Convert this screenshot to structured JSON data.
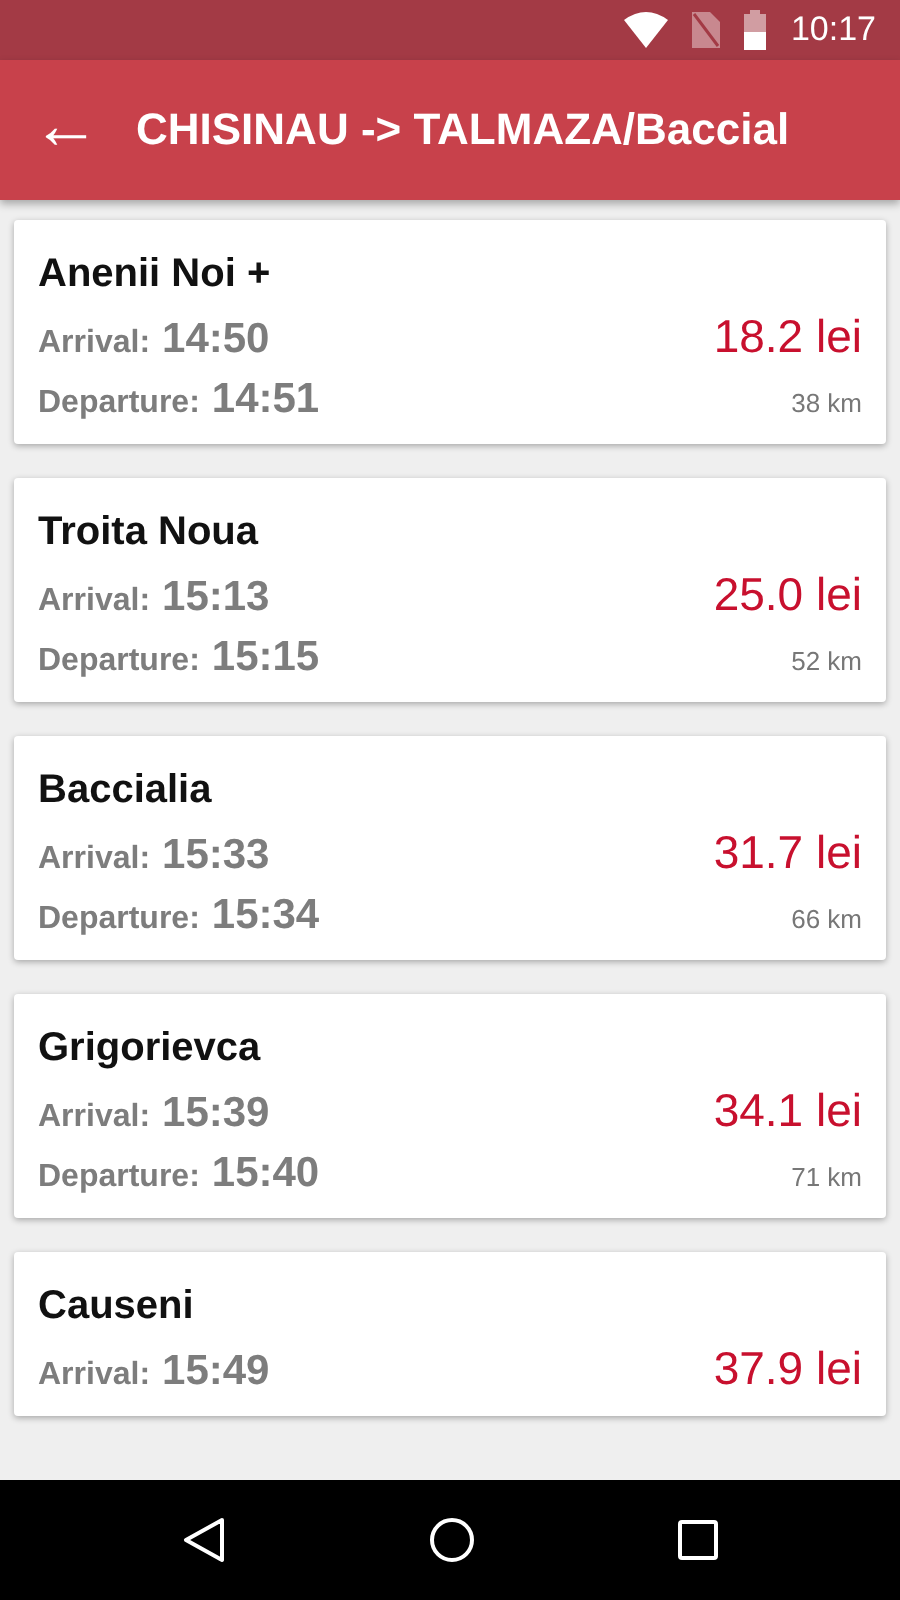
{
  "status_bar": {
    "time": "10:17"
  },
  "header": {
    "back": "←",
    "title": "CHISINAU -> TALMAZA/Baccial"
  },
  "stops": [
    {
      "name": "Anenii Noi +",
      "arrival_label": "Arrival:",
      "arrival": "14:50",
      "departure_label": "Departure:",
      "departure": "14:51",
      "price": "18.2 lei",
      "distance": "38 km"
    },
    {
      "name": "Troita Noua",
      "arrival_label": "Arrival:",
      "arrival": "15:13",
      "departure_label": "Departure:",
      "departure": "15:15",
      "price": "25.0 lei",
      "distance": "52 km"
    },
    {
      "name": "Baccialia",
      "arrival_label": "Arrival:",
      "arrival": "15:33",
      "departure_label": "Departure:",
      "departure": "15:34",
      "price": "31.7 lei",
      "distance": "66 km"
    },
    {
      "name": "Grigorievca",
      "arrival_label": "Arrival:",
      "arrival": "15:39",
      "departure_label": "Departure:",
      "departure": "15:40",
      "price": "34.1 lei",
      "distance": "71 km"
    },
    {
      "name": "Causeni",
      "arrival_label": "Arrival:",
      "arrival": "15:49",
      "price": "37.9 lei"
    }
  ]
}
